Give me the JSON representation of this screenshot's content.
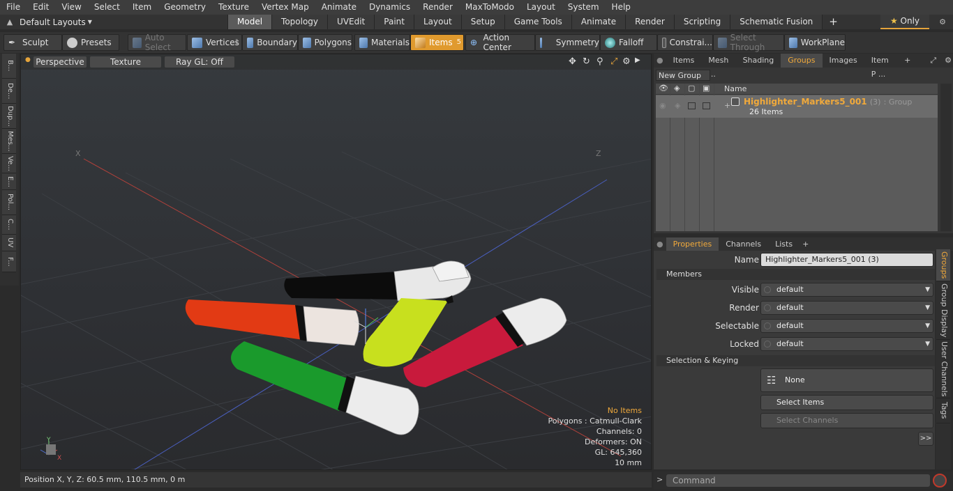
{
  "menu": [
    "File",
    "Edit",
    "View",
    "Select",
    "Item",
    "Geometry",
    "Texture",
    "Vertex Map",
    "Animate",
    "Dynamics",
    "Render",
    "MaxToModo",
    "Layout",
    "System",
    "Help"
  ],
  "layout_selector": "Default Layouts",
  "tabs": [
    "Model",
    "Topology",
    "UVEdit",
    "Paint",
    "Layout",
    "Setup",
    "Game Tools",
    "Animate",
    "Render",
    "Scripting",
    "Schematic Fusion"
  ],
  "active_tab": "Model",
  "only_button": "Only",
  "toolbar": {
    "sculpt": "Sculpt",
    "presets": "Presets",
    "auto_select": "Auto Select",
    "vertices": "Vertices",
    "vertices_count": "1",
    "boundary": "Boundary",
    "polygons": "Polygons",
    "materials": "Materials",
    "items": "Items",
    "items_count": "5",
    "action_center": "Action Center",
    "symmetry": "Symmetry",
    "falloff": "Falloff",
    "constraints": "Constrai...",
    "select_through": "Select Through",
    "workplane": "WorkPlane"
  },
  "left_tabs": [
    "B...",
    "De...",
    "Dup...",
    "Mes...",
    "Ve...",
    "E...",
    "Pol...",
    "C...",
    "UV",
    "F..."
  ],
  "viewport": {
    "perspective": "Perspective",
    "texture": "Texture",
    "raygl": "Ray GL: Off",
    "info": {
      "no_items": "No Items",
      "polygons": "Polygons : Catmull-Clark",
      "channels": "Channels: 0",
      "deformers": "Deformers: ON",
      "gl": "GL: 645,360",
      "scale": "10 mm"
    },
    "axis_labels": {
      "x_left": "X",
      "z_right": "Z",
      "gizmo_y": "Y",
      "gizmo_x": "X"
    }
  },
  "status": "Position X, Y, Z:   60.5 mm, 110.5 mm, 0 m",
  "right_panel": {
    "tabs": [
      "Items",
      "Mesh ...",
      "Shading",
      "Groups",
      "Images",
      "Item P ..."
    ],
    "active_tab": "Groups",
    "new_group": "New Group",
    "column_name": "Name",
    "group": {
      "name": "Highlighter_Markers5_001",
      "count": "(3)",
      "type": ": Group",
      "items": "26 Items"
    }
  },
  "properties": {
    "tabs": [
      "Properties",
      "Channels",
      "Lists"
    ],
    "name_label": "Name",
    "name_value": "Highlighter_Markers5_001 (3)",
    "members_section": "Members",
    "visible_label": "Visible",
    "visible_value": "default",
    "render_label": "Render",
    "render_value": "default",
    "selectable_label": "Selectable",
    "selectable_value": "default",
    "locked_label": "Locked",
    "locked_value": "default",
    "keying_section": "Selection & Keying",
    "none_button": "None",
    "select_items": "Select Items",
    "select_channels": "Select Channels",
    "more": ">>"
  },
  "side_tabs": [
    "Groups",
    "Group Display",
    "User Channels",
    "Tags"
  ],
  "command_placeholder": "Command",
  "colors": {
    "accent": "#f0a93b",
    "marker_red": "#e23a14",
    "marker_green": "#1a9a2c",
    "marker_yellow": "#c8e01e",
    "marker_crimson": "#c81a3c",
    "marker_black": "#0c0c0c"
  }
}
